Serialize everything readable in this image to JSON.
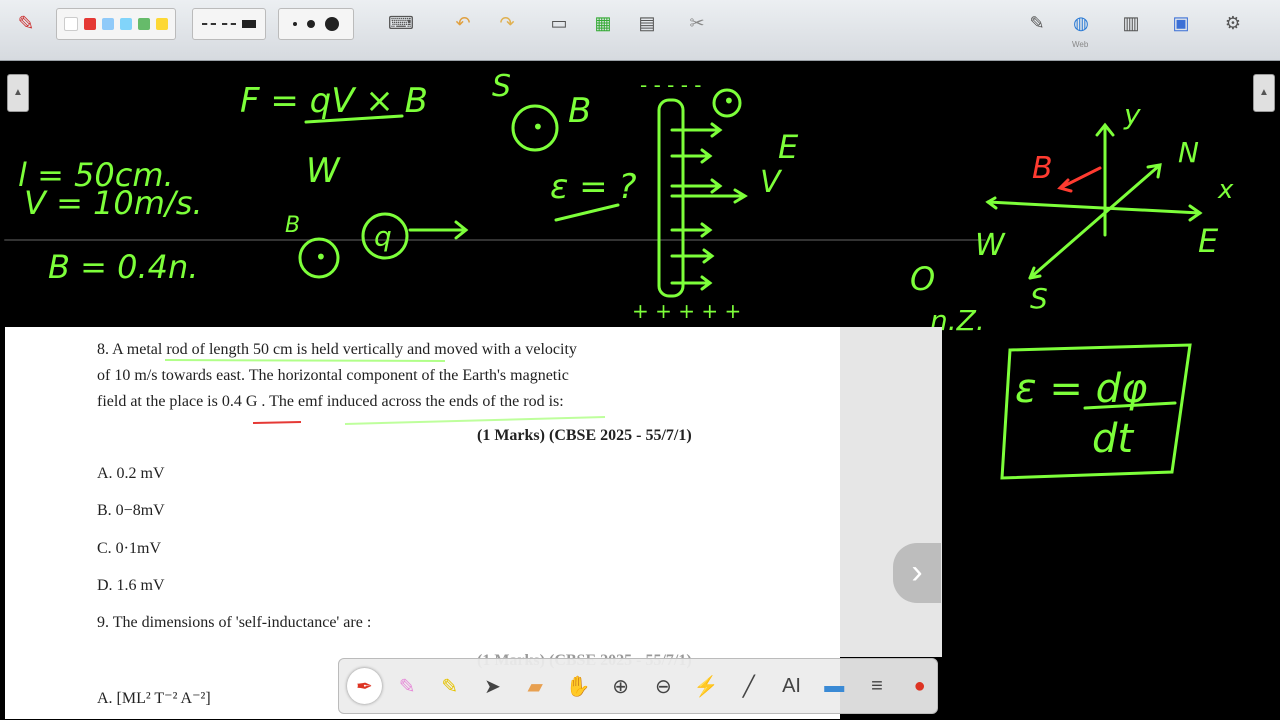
{
  "toolbar": {
    "logo": "✎",
    "colors": [
      "#ffffff",
      "#e53935",
      "#90caf9",
      "#81d4fa",
      "#66bb6a",
      "#fdd835"
    ],
    "line_styles": [
      "dash",
      "dash",
      "solid"
    ],
    "dot_sizes": [
      "small",
      "medium",
      "large"
    ],
    "right_label": "Web"
  },
  "board": {
    "ink_color": "#7dff3a",
    "accent_color": "#ff3b30",
    "texts": {
      "force": "F = qV × B",
      "w_left": "W",
      "l_val": "l = 50cm.",
      "v_val": "V = 10m/s.",
      "b_val": "B = 0.4n.",
      "b_small": "B",
      "q": "q",
      "s_top": "S",
      "b_mid": "B",
      "emf_q": "ε = ?",
      "e_top": "E",
      "v_right": "V",
      "axis_y": "y",
      "axis_n": "N",
      "axis_x": "x",
      "axis_b": "B",
      "axis_w": "W",
      "axis_e": "E",
      "axis_s": "S",
      "o_label": "O",
      "nz": "n.Z.",
      "formula_num": "ε = dφ",
      "formula_den": "dt"
    }
  },
  "doc": {
    "q8_line1": "8. A metal rod of length 50 cm is held vertically and moved with a velocity",
    "q8_line2": "of 10 m/s towards east. The horizontal component of the Earth's magnetic",
    "q8_line3": "field at the place is 0.4 G . The emf induced across the ends of the rod is:",
    "q8_marks": "(1 Marks) (CBSE 2025 - 55/7/1)",
    "opt_a": "A. 0.2 mV",
    "opt_b": "B. 0−8mV",
    "opt_c": "C. 0·1mV",
    "opt_d": "D. 1.6 mV",
    "q9": "9. The dimensions of 'self-inductance' are :",
    "q9_marks": "(1 Marks) (CBSE 2025 - 55/7/1)",
    "q9_opt_a": "A. [ML² T⁻² A⁻²]"
  },
  "nav": {
    "next": "›"
  },
  "bottom_tools": [
    "pen",
    "highlighter-pink",
    "highlighter-yellow",
    "pointer",
    "eraser",
    "hand",
    "zoom-in",
    "zoom-out",
    "laser",
    "line",
    "text",
    "image",
    "menu",
    "record"
  ],
  "bottom_labels": {
    "text_tool": "AI"
  }
}
